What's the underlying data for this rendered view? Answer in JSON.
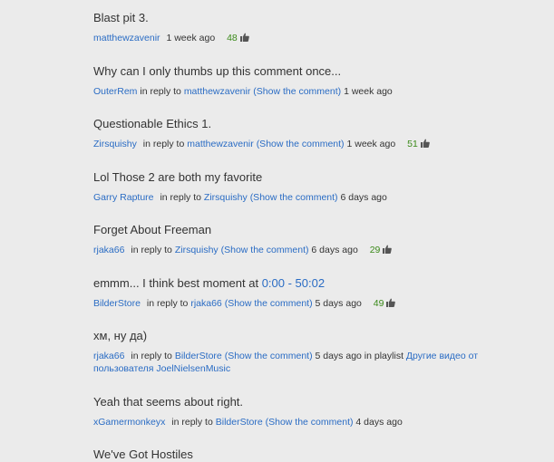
{
  "comments": [
    {
      "text": "Blast pit 3.",
      "author": "matthewzavenir",
      "time": "1 week ago",
      "likes": "48"
    },
    {
      "text": "Why can I only thumbs up this comment once...",
      "author": "OuterRem",
      "in_reply_to": "in reply to",
      "reply_author": "matthewzavenir",
      "show": "(Show the comment)",
      "time": "1 week ago"
    },
    {
      "text": "Questionable Ethics 1.",
      "author": "Zirsquishy",
      "in_reply_to": "in reply to",
      "reply_author": "matthewzavenir",
      "show": "(Show the comment)",
      "time": "1 week ago",
      "likes": "51"
    },
    {
      "text": "Lol Those 2 are both my favorite",
      "author": "Garry Rapture",
      "in_reply_to": "in reply to",
      "reply_author": "Zirsquishy",
      "show": "(Show the comment)",
      "time": "6 days ago"
    },
    {
      "text": "Forget About Freeman",
      "author": "rjaka66",
      "in_reply_to": "in reply to",
      "reply_author": "Zirsquishy",
      "show": "(Show the comment)",
      "time": "6 days ago",
      "likes": "29"
    },
    {
      "text_prefix": "emmm... I think best moment at",
      "time_link": "0:00 - 50:02",
      "author": "BilderStore",
      "in_reply_to": "in reply to",
      "reply_author": "rjaka66",
      "show": "(Show the comment)",
      "time": "5 days ago",
      "likes": "49"
    },
    {
      "text": "хм, ну да)",
      "author": "rjaka66",
      "in_reply_to": "in reply to",
      "reply_author": "BilderStore",
      "show": "(Show the comment)",
      "time": "5 days ago",
      "in_playlist": "in playlist",
      "playlist_line1": "Другие видео от",
      "playlist_line2": "пользователя JoelNielsenMusic"
    },
    {
      "text": "Yeah that seems about right.",
      "author": "xGamermonkeyx",
      "in_reply_to": "in reply to",
      "reply_author": "BilderStore",
      "show": "(Show the comment)",
      "time": "4 days ago"
    },
    {
      "text": "We've Got Hostiles"
    }
  ]
}
